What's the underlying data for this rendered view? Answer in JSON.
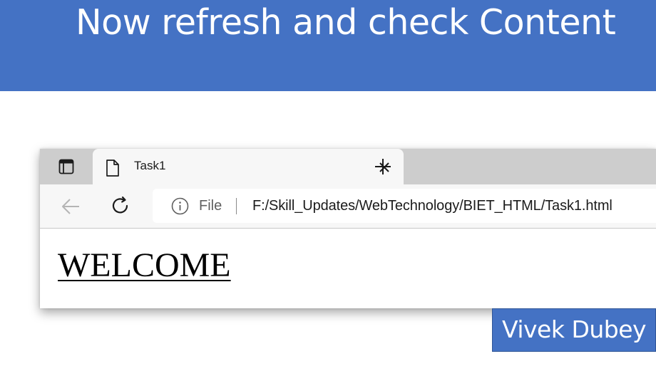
{
  "slide": {
    "title": "Now refresh and check Content",
    "author": "Vivek Dubey",
    "accent_color": "#4472c4"
  },
  "browser": {
    "tab": {
      "title": "Task1",
      "favicon": "page-icon"
    },
    "toolbar": {
      "back_icon": "back-arrow-icon",
      "refresh_icon": "refresh-icon",
      "info_icon": "info-icon",
      "scheme_label": "File",
      "url": "F:/Skill_Updates/WebTechnology/BIET_HTML/Task1.html"
    },
    "page": {
      "heading": "WELCOME"
    }
  }
}
